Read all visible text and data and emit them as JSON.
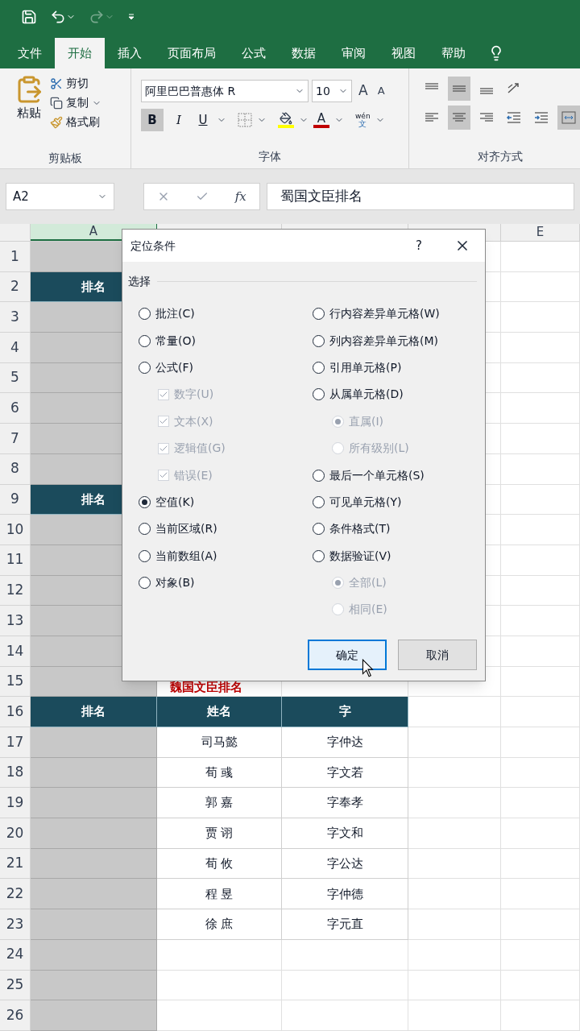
{
  "tabs": [
    {
      "label": "文件",
      "selected": false
    },
    {
      "label": "开始",
      "selected": true
    },
    {
      "label": "插入",
      "selected": false
    },
    {
      "label": "页面布局",
      "selected": false
    },
    {
      "label": "公式",
      "selected": false
    },
    {
      "label": "数据",
      "selected": false
    },
    {
      "label": "审阅",
      "selected": false
    },
    {
      "label": "视图",
      "selected": false
    },
    {
      "label": "帮助",
      "selected": false
    }
  ],
  "ribbon": {
    "clipboard": {
      "paste": "粘贴",
      "cut": "剪切",
      "copy": "复制",
      "format_painter": "格式刷",
      "label": "剪贴板"
    },
    "font": {
      "font_name": "阿里巴巴普惠体 R",
      "font_size": "10",
      "grow": "A",
      "shrink": "A",
      "bold": {
        "label": "B",
        "selected": true
      },
      "italic": "I",
      "underline": "U",
      "font_color": "A",
      "phonetic_top": "wén",
      "phonetic_bottom": "文",
      "label": "字体"
    },
    "alignment": {
      "label": "对齐方式",
      "top_row": [
        {
          "kind": "top",
          "selected": false
        },
        {
          "kind": "middle",
          "selected": true
        },
        {
          "kind": "bottom",
          "selected": false
        },
        {
          "kind": "orientation",
          "selected": false
        }
      ],
      "bottom_row": [
        {
          "kind": "left",
          "selected": false
        },
        {
          "kind": "center",
          "selected": true
        },
        {
          "kind": "right",
          "selected": false
        },
        {
          "kind": "outdent",
          "selected": false
        },
        {
          "kind": "indent",
          "selected": false
        },
        {
          "kind": "merge",
          "selected": true
        }
      ]
    }
  },
  "formula_bar": {
    "name_box": "A2",
    "fx": "fx",
    "formula": "蜀国文臣排名"
  },
  "sheet": {
    "columns": [
      {
        "label": "A",
        "selected": true
      },
      {
        "selected": false
      },
      {
        "selected": false
      },
      {
        "selected": false
      },
      {
        "label": "E",
        "selected": false
      }
    ],
    "rows": [
      {
        "number": "1"
      },
      {
        "number": "2",
        "a": {
          "text": "排名",
          "kind": "header"
        }
      },
      {
        "number": "3"
      },
      {
        "number": "4"
      },
      {
        "number": "5"
      },
      {
        "number": "6"
      },
      {
        "number": "7"
      },
      {
        "number": "8"
      },
      {
        "number": "9",
        "a": {
          "text": "排名",
          "kind": "header"
        }
      },
      {
        "number": "10"
      },
      {
        "number": "11"
      },
      {
        "number": "12"
      },
      {
        "number": "13"
      },
      {
        "number": "14"
      },
      {
        "number": "15",
        "b": {
          "text": "魏国文臣排名",
          "kind": "title"
        }
      },
      {
        "number": "16",
        "a": {
          "text": "排名",
          "kind": "header"
        },
        "b": {
          "text": "姓名",
          "kind": "header"
        },
        "c": {
          "text": "字",
          "kind": "header"
        }
      },
      {
        "number": "17",
        "b": {
          "text": "司马懿",
          "kind": "data"
        },
        "c": {
          "text": "字仲达",
          "kind": "data"
        }
      },
      {
        "number": "18",
        "b": {
          "text": "荀 彧",
          "kind": "data"
        },
        "c": {
          "text": "字文若",
          "kind": "data"
        }
      },
      {
        "number": "19",
        "b": {
          "text": "郭 嘉",
          "kind": "data"
        },
        "c": {
          "text": "字奉孝",
          "kind": "data"
        }
      },
      {
        "number": "20",
        "b": {
          "text": "贾 诩",
          "kind": "data"
        },
        "c": {
          "text": "字文和",
          "kind": "data"
        }
      },
      {
        "number": "21",
        "b": {
          "text": "荀 攸",
          "kind": "data"
        },
        "c": {
          "text": "字公达",
          "kind": "data"
        }
      },
      {
        "number": "22",
        "b": {
          "text": "程 昱",
          "kind": "data"
        },
        "c": {
          "text": "字仲德",
          "kind": "data"
        }
      },
      {
        "number": "23",
        "b": {
          "text": "徐 庶",
          "kind": "data"
        },
        "c": {
          "text": "字元直",
          "kind": "data"
        }
      },
      {
        "number": "24"
      },
      {
        "number": "25"
      },
      {
        "number": "26"
      }
    ]
  },
  "dialog": {
    "title": "定位条件",
    "help": "?",
    "section": "选择",
    "left_options": [
      {
        "label": "批注(C)",
        "kind": "radio",
        "selected": false,
        "disabled": false
      },
      {
        "label": "常量(O)",
        "kind": "radio",
        "selected": false,
        "disabled": false
      },
      {
        "label": "公式(F)",
        "kind": "radio",
        "selected": false,
        "disabled": false,
        "children": [
          {
            "label": "数字(U)",
            "kind": "checkbox",
            "selected": true,
            "disabled": true
          },
          {
            "label": "文本(X)",
            "kind": "checkbox",
            "selected": true,
            "disabled": true
          },
          {
            "label": "逻辑值(G)",
            "kind": "checkbox",
            "selected": true,
            "disabled": true
          },
          {
            "label": "错误(E)",
            "kind": "checkbox",
            "selected": true,
            "disabled": true
          }
        ]
      },
      {
        "label": "空值(K)",
        "kind": "radio",
        "selected": true,
        "disabled": false
      },
      {
        "label": "当前区域(R)",
        "kind": "radio",
        "selected": false,
        "disabled": false
      },
      {
        "label": "当前数组(A)",
        "kind": "radio",
        "selected": false,
        "disabled": false
      },
      {
        "label": "对象(B)",
        "kind": "radio",
        "selected": false,
        "disabled": false
      }
    ],
    "right_options": [
      {
        "label": "行内容差异单元格(W)",
        "kind": "radio",
        "selected": false,
        "disabled": false
      },
      {
        "label": "列内容差异单元格(M)",
        "kind": "radio",
        "selected": false,
        "disabled": false
      },
      {
        "label": "引用单元格(P)",
        "kind": "radio",
        "selected": false,
        "disabled": false
      },
      {
        "label": "从属单元格(D)",
        "kind": "radio",
        "selected": false,
        "disabled": false,
        "children": [
          {
            "label": "直属(I)",
            "kind": "radio",
            "selected": true,
            "disabled": true
          },
          {
            "label": "所有级别(L)",
            "kind": "radio",
            "selected": false,
            "disabled": true
          }
        ]
      },
      {
        "label": "最后一个单元格(S)",
        "kind": "radio",
        "selected": false,
        "disabled": false
      },
      {
        "label": "可见单元格(Y)",
        "kind": "radio",
        "selected": false,
        "disabled": false
      },
      {
        "label": "条件格式(T)",
        "kind": "radio",
        "selected": false,
        "disabled": false
      },
      {
        "label": "数据验证(V)",
        "kind": "radio",
        "selected": false,
        "disabled": false,
        "children": [
          {
            "label": "全部(L)",
            "kind": "radio",
            "selected": true,
            "disabled": true
          },
          {
            "label": "相同(E)",
            "kind": "radio",
            "selected": false,
            "disabled": true
          }
        ]
      }
    ],
    "buttons": [
      {
        "label": "确定",
        "default": true
      },
      {
        "label": "取消",
        "default": false
      }
    ]
  }
}
